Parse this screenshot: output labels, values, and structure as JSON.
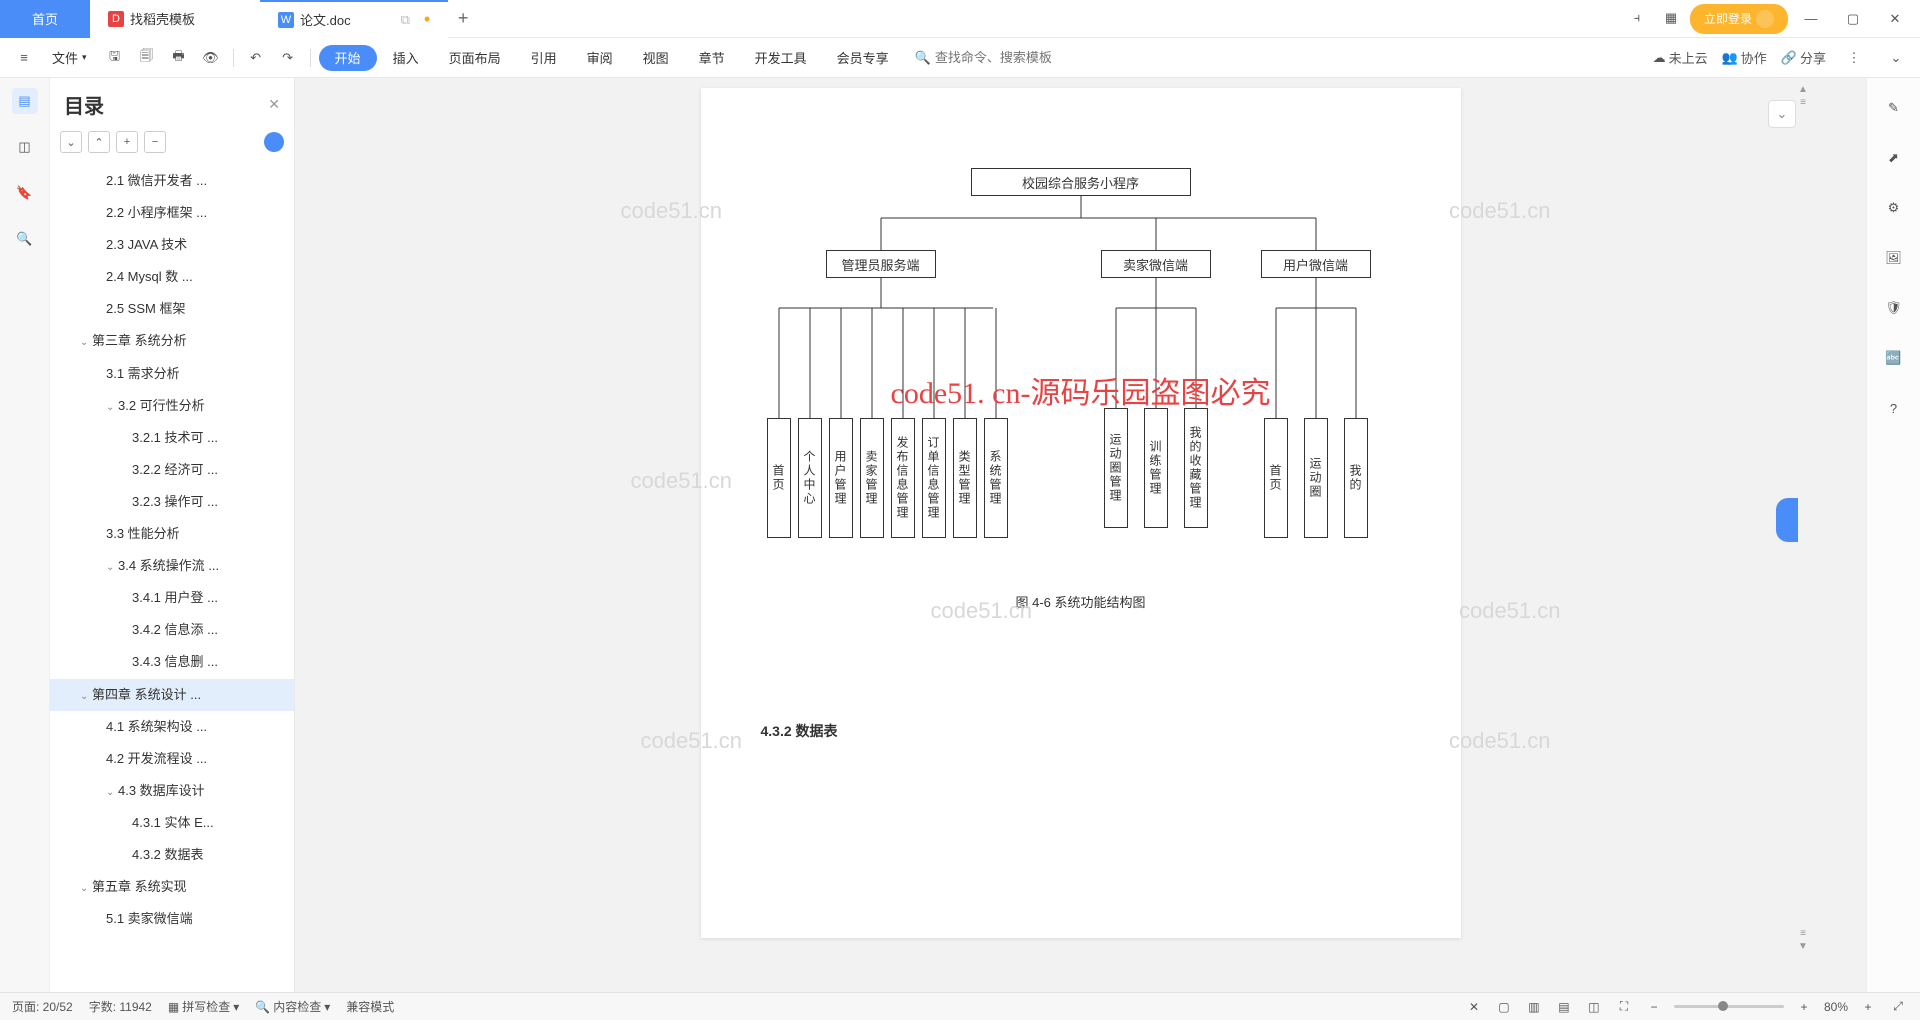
{
  "tabs": {
    "home": "首页",
    "template": "找稻壳模板",
    "doc": "论文.doc"
  },
  "login": "立即登录",
  "ribbon": {
    "file": "文件",
    "items": [
      "开始",
      "插入",
      "页面布局",
      "引用",
      "审阅",
      "视图",
      "章节",
      "开发工具",
      "会员专享"
    ],
    "search_ph": "查找命令、搜索模板",
    "cloud": "未上云",
    "collab": "协作",
    "share": "分享"
  },
  "toc": {
    "title": "目录",
    "items": [
      {
        "t": "2.1 微信开发者 ...",
        "lv": 2
      },
      {
        "t": "2.2 小程序框架 ...",
        "lv": 2
      },
      {
        "t": "2.3 JAVA 技术",
        "lv": 2
      },
      {
        "t": "2.4   Mysql 数 ...",
        "lv": 2
      },
      {
        "t": "2.5 SSM 框架",
        "lv": 2
      },
      {
        "t": "第三章  系统分析",
        "lv": 1,
        "c": 1
      },
      {
        "t": "3.1 需求分析",
        "lv": 2
      },
      {
        "t": "3.2 可行性分析",
        "lv": 2,
        "c": 1
      },
      {
        "t": "3.2.1 技术可 ...",
        "lv": 3
      },
      {
        "t": "3.2.2 经济可 ...",
        "lv": 3
      },
      {
        "t": "3.2.3 操作可 ...",
        "lv": 3
      },
      {
        "t": "3.3 性能分析",
        "lv": 2
      },
      {
        "t": "3.4 系统操作流 ...",
        "lv": 2,
        "c": 1
      },
      {
        "t": "3.4.1 用户登 ...",
        "lv": 3
      },
      {
        "t": "3.4.2 信息添 ...",
        "lv": 3
      },
      {
        "t": "3.4.3 信息删 ...",
        "lv": 3
      },
      {
        "t": "第四章  系统设计 ...",
        "lv": 1,
        "c": 1,
        "sel": 1
      },
      {
        "t": "4.1  系统架构设 ...",
        "lv": 2
      },
      {
        "t": "4.2 开发流程设 ...",
        "lv": 2
      },
      {
        "t": "4.3 数据库设计",
        "lv": 2,
        "c": 1
      },
      {
        "t": "4.3.1 实体 E...",
        "lv": 3
      },
      {
        "t": "4.3.2 数据表",
        "lv": 3
      },
      {
        "t": "第五章  系统实现",
        "lv": 1,
        "c": 1
      },
      {
        "t": "5.1 卖家微信端",
        "lv": 2
      }
    ]
  },
  "doc": {
    "root": "校园综合服务小程序",
    "mid": [
      "管理员服务端",
      "卖家微信端",
      "用户微信端"
    ],
    "admin": [
      "首页",
      "个人中心",
      "用户管理",
      "卖家管理",
      "发布信息管理",
      "订单信息管理",
      "类型管理",
      "系统管理"
    ],
    "seller": [
      "运动圈管理",
      "训练管理",
      "我的收藏管理"
    ],
    "user": [
      "首页",
      "运动圈",
      "我的"
    ],
    "caption": "图 4-6 系统功能结构图",
    "section": "4.3.2 数据表",
    "red": "code51. cn-源码乐园盗图必究",
    "wm": "code51.cn"
  },
  "status": {
    "page": "页面: 20/52",
    "words": "字数: 11942",
    "spell": "拼写检查",
    "content": "内容检查",
    "compat": "兼容模式",
    "zoom": "80%"
  }
}
